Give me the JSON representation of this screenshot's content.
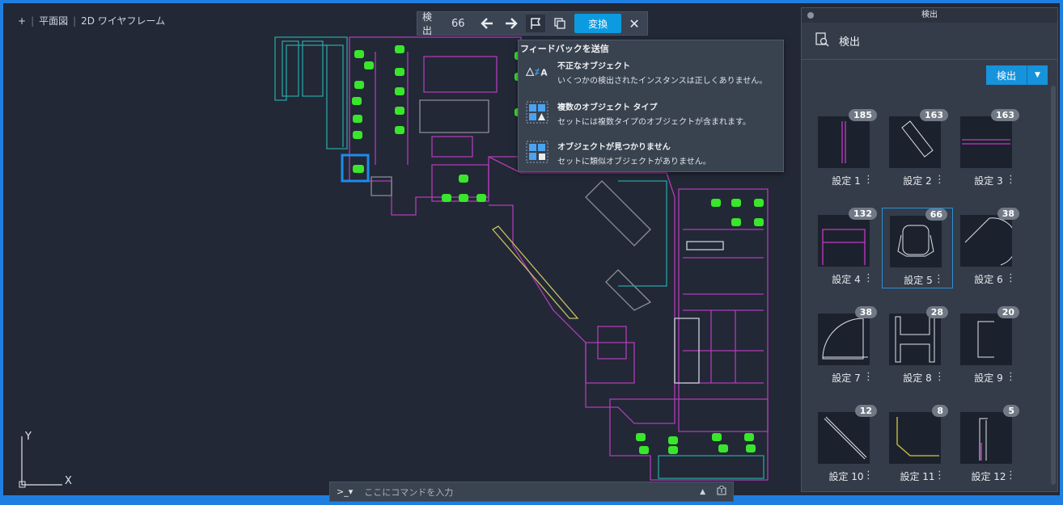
{
  "viewport": {
    "plus": "+",
    "view_name": "平面図",
    "visual_style": "2D ワイヤフレーム",
    "ucs_y": "Y",
    "ucs_x": "X"
  },
  "toolbar": {
    "label": "検出",
    "count": "66",
    "convert_label": "変換",
    "close_label": "✕"
  },
  "feedback": {
    "title": "フィードバックを送信",
    "items": [
      {
        "title": "不正なオブジェクト",
        "desc": "いくつかの検出されたインスタンスは正しくありません。",
        "icon": "triangle-notequal-a-icon"
      },
      {
        "title": "複数のオブジェクト タイプ",
        "desc": "セットには複数タイプのオブジェクトが含まれます。",
        "icon": "multi-shape-icon"
      },
      {
        "title": "オブジェクトが見つかりません",
        "desc": "セットに類似オブジェクトがありません。",
        "icon": "missing-object-icon"
      }
    ]
  },
  "command": {
    "prompt": ">_▾",
    "placeholder": "ここにコマンドを入力"
  },
  "panel": {
    "window_title": "検出",
    "header": "検出",
    "detect_button": "検出",
    "sets": [
      {
        "name": "設定 1",
        "count": "185"
      },
      {
        "name": "設定 2",
        "count": "163"
      },
      {
        "name": "設定 3",
        "count": "163"
      },
      {
        "name": "設定 4",
        "count": "132"
      },
      {
        "name": "設定 5",
        "count": "66"
      },
      {
        "name": "設定 6",
        "count": "38"
      },
      {
        "name": "設定 7",
        "count": "38"
      },
      {
        "name": "設定 8",
        "count": "28"
      },
      {
        "name": "設定 9",
        "count": "20"
      },
      {
        "name": "設定 10",
        "count": "12"
      },
      {
        "name": "設定 11",
        "count": "8"
      },
      {
        "name": "設定 12",
        "count": "5"
      }
    ]
  },
  "colors": {
    "accent": "#1f7fe0",
    "button": "#0c9be0",
    "detected": "#39e62b",
    "wall_magenta": "#b23bb8",
    "wall_teal": "#2aa3a3"
  }
}
